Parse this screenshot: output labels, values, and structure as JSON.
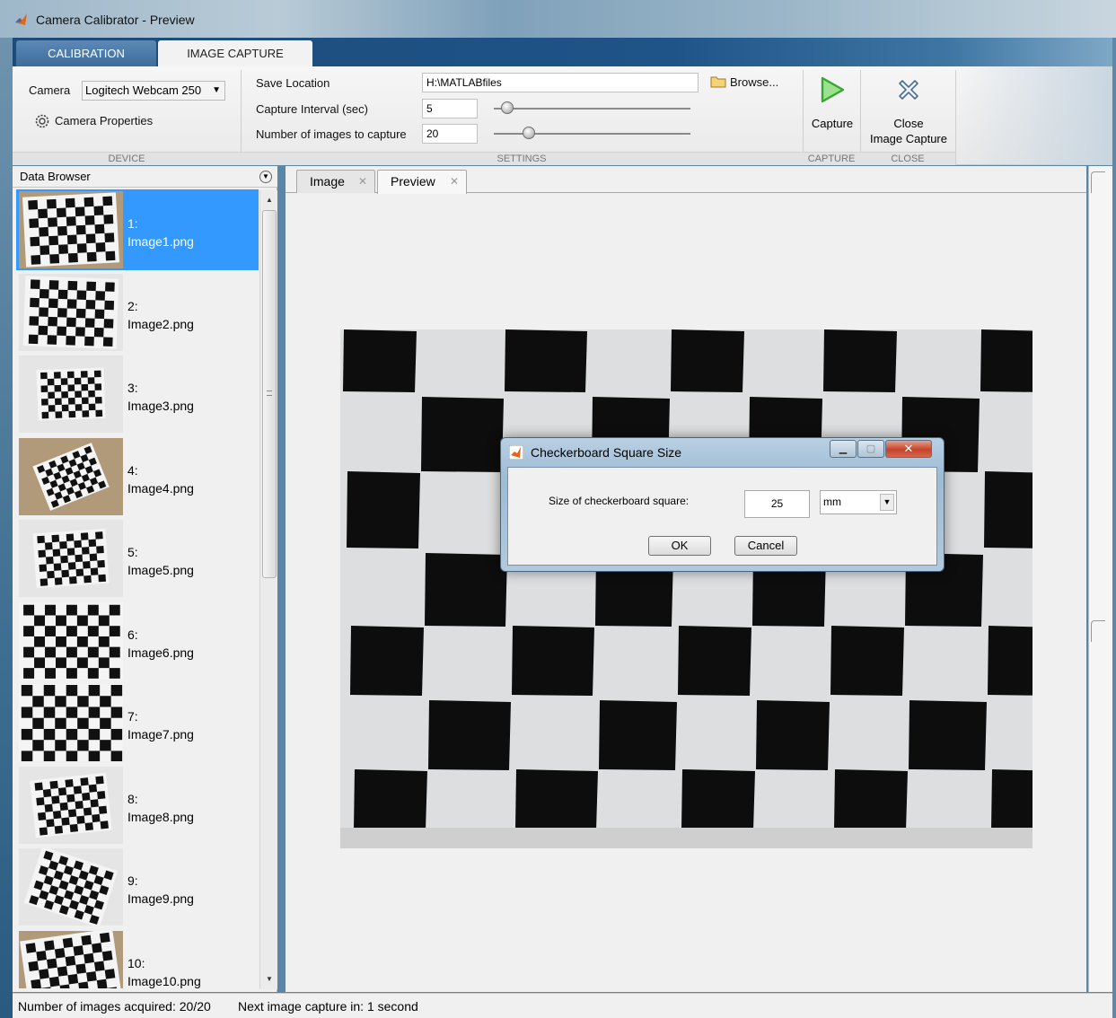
{
  "window": {
    "title": "Camera Calibrator - Preview"
  },
  "ribbon": {
    "tabs": [
      {
        "label": "CALIBRATION"
      },
      {
        "label": "IMAGE CAPTURE"
      }
    ],
    "device": {
      "camera_label": "Camera",
      "camera_value": "Logitech Webcam 250",
      "properties_label": "Camera Properties",
      "group_label": "DEVICE"
    },
    "settings": {
      "save_location_label": "Save Location",
      "save_location_value": "H:\\MATLABfiles",
      "browse_label": "Browse...",
      "interval_label": "Capture Interval (sec)",
      "interval_value": "5",
      "num_images_label": "Number of images to capture",
      "num_images_value": "20",
      "group_label": "SETTINGS"
    },
    "capture": {
      "button_label": "Capture",
      "group_label": "CAPTURE"
    },
    "close": {
      "button_line1": "Close",
      "button_line2": "Image Capture",
      "group_label": "CLOSE"
    }
  },
  "data_browser": {
    "title": "Data Browser",
    "items": [
      {
        "index": "1:",
        "name": "Image1.png",
        "selected": true
      },
      {
        "index": "2:",
        "name": "Image2.png"
      },
      {
        "index": "3:",
        "name": "Image3.png"
      },
      {
        "index": "4:",
        "name": "Image4.png"
      },
      {
        "index": "5:",
        "name": "Image5.png"
      },
      {
        "index": "6:",
        "name": "Image6.png"
      },
      {
        "index": "7:",
        "name": "Image7.png"
      },
      {
        "index": "8:",
        "name": "Image8.png"
      },
      {
        "index": "9:",
        "name": "Image9.png"
      },
      {
        "index": "10:",
        "name": "Image10.png"
      }
    ]
  },
  "document_tabs": [
    {
      "label": "Image"
    },
    {
      "label": "Preview"
    }
  ],
  "dialog": {
    "title": "Checkerboard Square Size",
    "question": "Size of checkerboard square:",
    "size_value": "25",
    "unit_value": "mm",
    "ok_label": "OK",
    "cancel_label": "Cancel"
  },
  "status": {
    "acquired": "Number of images acquired: 20/20",
    "next_capture": "Next image capture in: 1 second"
  },
  "colors": {
    "selection": "#3399ff",
    "ribbon_tab_bar": "#1f5488",
    "capture_icon": "#3aa533"
  }
}
